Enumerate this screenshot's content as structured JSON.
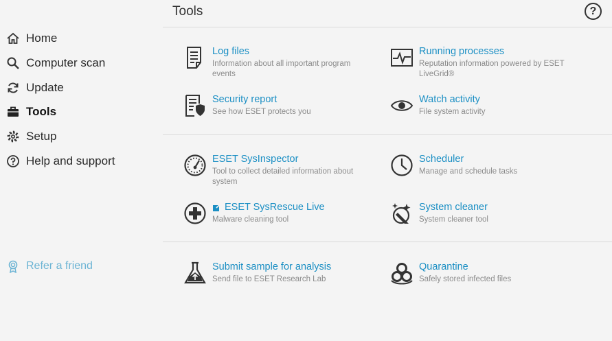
{
  "sidebar": {
    "items": [
      {
        "label": "Home",
        "icon": "home-icon"
      },
      {
        "label": "Computer scan",
        "icon": "search-icon"
      },
      {
        "label": "Update",
        "icon": "refresh-icon"
      },
      {
        "label": "Tools",
        "icon": "briefcase-icon",
        "active": true
      },
      {
        "label": "Setup",
        "icon": "gear-icon"
      },
      {
        "label": "Help and support",
        "icon": "help-icon"
      }
    ],
    "refer": {
      "label": "Refer a friend",
      "icon": "award-icon"
    }
  },
  "header": {
    "title": "Tools",
    "help_label": "?"
  },
  "tools": [
    {
      "title": "Log files",
      "desc": "Information about all important program events",
      "icon": "log-file-icon"
    },
    {
      "title": "Running processes",
      "desc": "Reputation information powered by ESET LiveGrid®",
      "icon": "pulse-monitor-icon"
    },
    {
      "title": "Security report",
      "desc": "See how ESET protects you",
      "icon": "security-report-icon"
    },
    {
      "title": "Watch activity",
      "desc": "File system activity",
      "icon": "eye-icon"
    },
    {
      "title": "ESET SysInspector",
      "desc": "Tool to collect detailed information about system",
      "icon": "gauge-icon"
    },
    {
      "title": "Scheduler",
      "desc": "Manage and schedule tasks",
      "icon": "clock-icon"
    },
    {
      "title": "ESET SysRescue Live",
      "desc": "Malware cleaning tool",
      "icon": "rescue-plus-icon"
    },
    {
      "title": "System cleaner",
      "desc": "System cleaner tool",
      "icon": "system-cleaner-icon"
    },
    {
      "title": "Submit sample for analysis",
      "desc": "Send file to ESET Research Lab",
      "icon": "flask-icon"
    },
    {
      "title": "Quarantine",
      "desc": "Safely stored infected files",
      "icon": "biohazard-icon"
    }
  ],
  "colors": {
    "accent": "#1b8fc4",
    "refer": "#6cb4d4",
    "background": "#f4f4f4"
  }
}
